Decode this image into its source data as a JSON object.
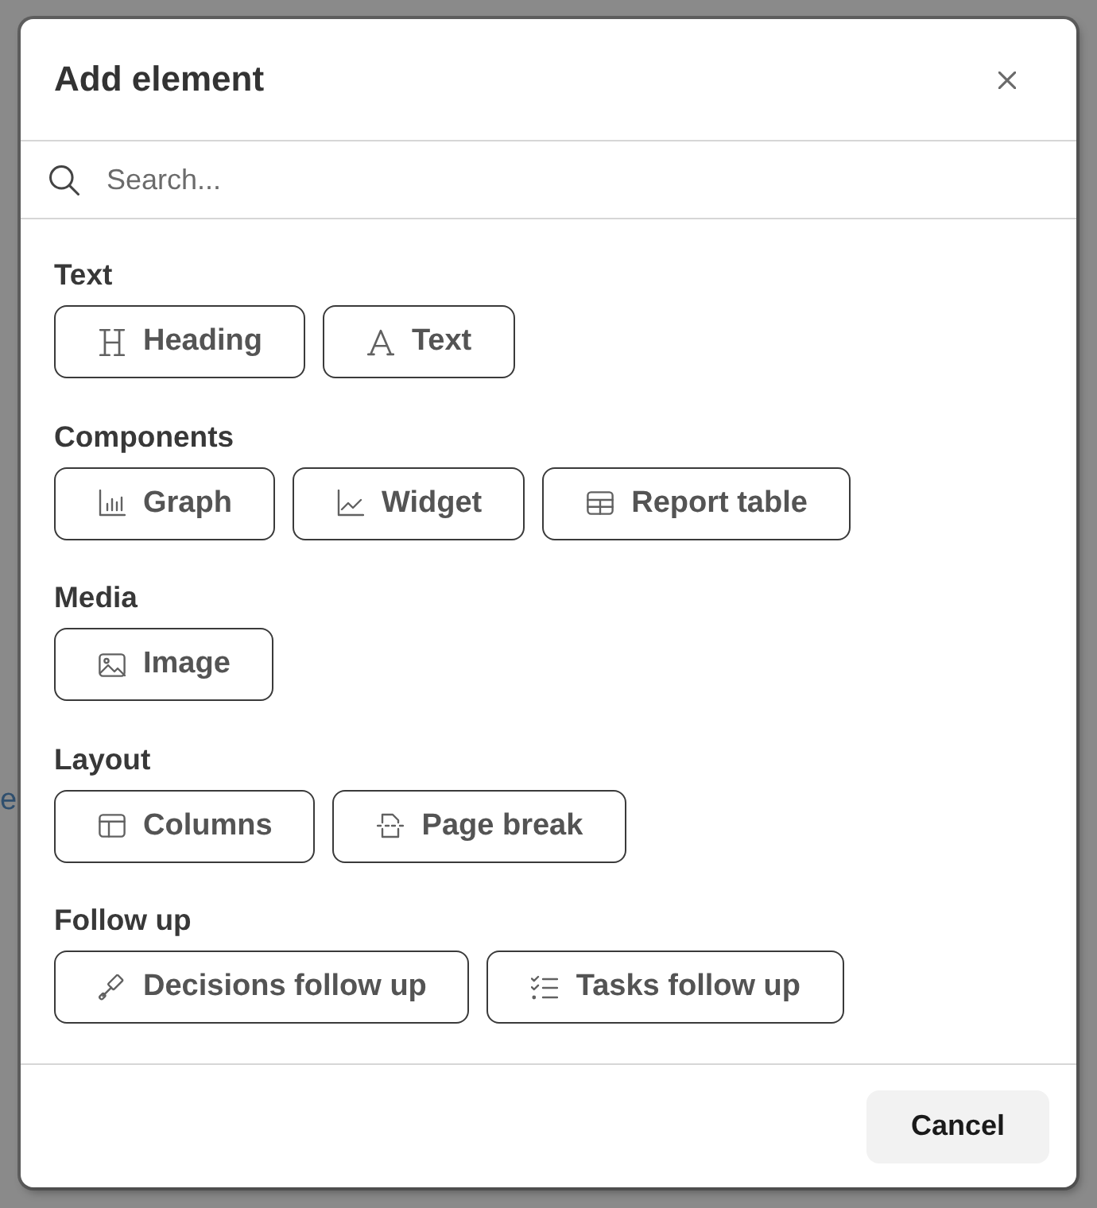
{
  "backdrop": {
    "text": "e"
  },
  "dialog": {
    "title": "Add element",
    "search": {
      "placeholder": "Search..."
    },
    "sections": [
      {
        "title": "Text",
        "items": [
          {
            "label": "Heading",
            "kind": "heading"
          },
          {
            "label": "Text",
            "kind": "text"
          }
        ]
      },
      {
        "title": "Components",
        "items": [
          {
            "label": "Graph",
            "kind": "graph"
          },
          {
            "label": "Widget",
            "kind": "widget"
          },
          {
            "label": "Report table",
            "kind": "table"
          }
        ]
      },
      {
        "title": "Media",
        "items": [
          {
            "label": "Image",
            "kind": "image"
          }
        ]
      },
      {
        "title": "Layout",
        "items": [
          {
            "label": "Columns",
            "kind": "columns"
          },
          {
            "label": "Page break",
            "kind": "page_break"
          }
        ]
      },
      {
        "title": "Follow up",
        "items": [
          {
            "label": "Decisions follow up",
            "kind": "decisions"
          },
          {
            "label": "Tasks follow up",
            "kind": "tasks"
          }
        ]
      }
    ],
    "buttons": [
      {
        "label": "Cancel"
      }
    ]
  }
}
